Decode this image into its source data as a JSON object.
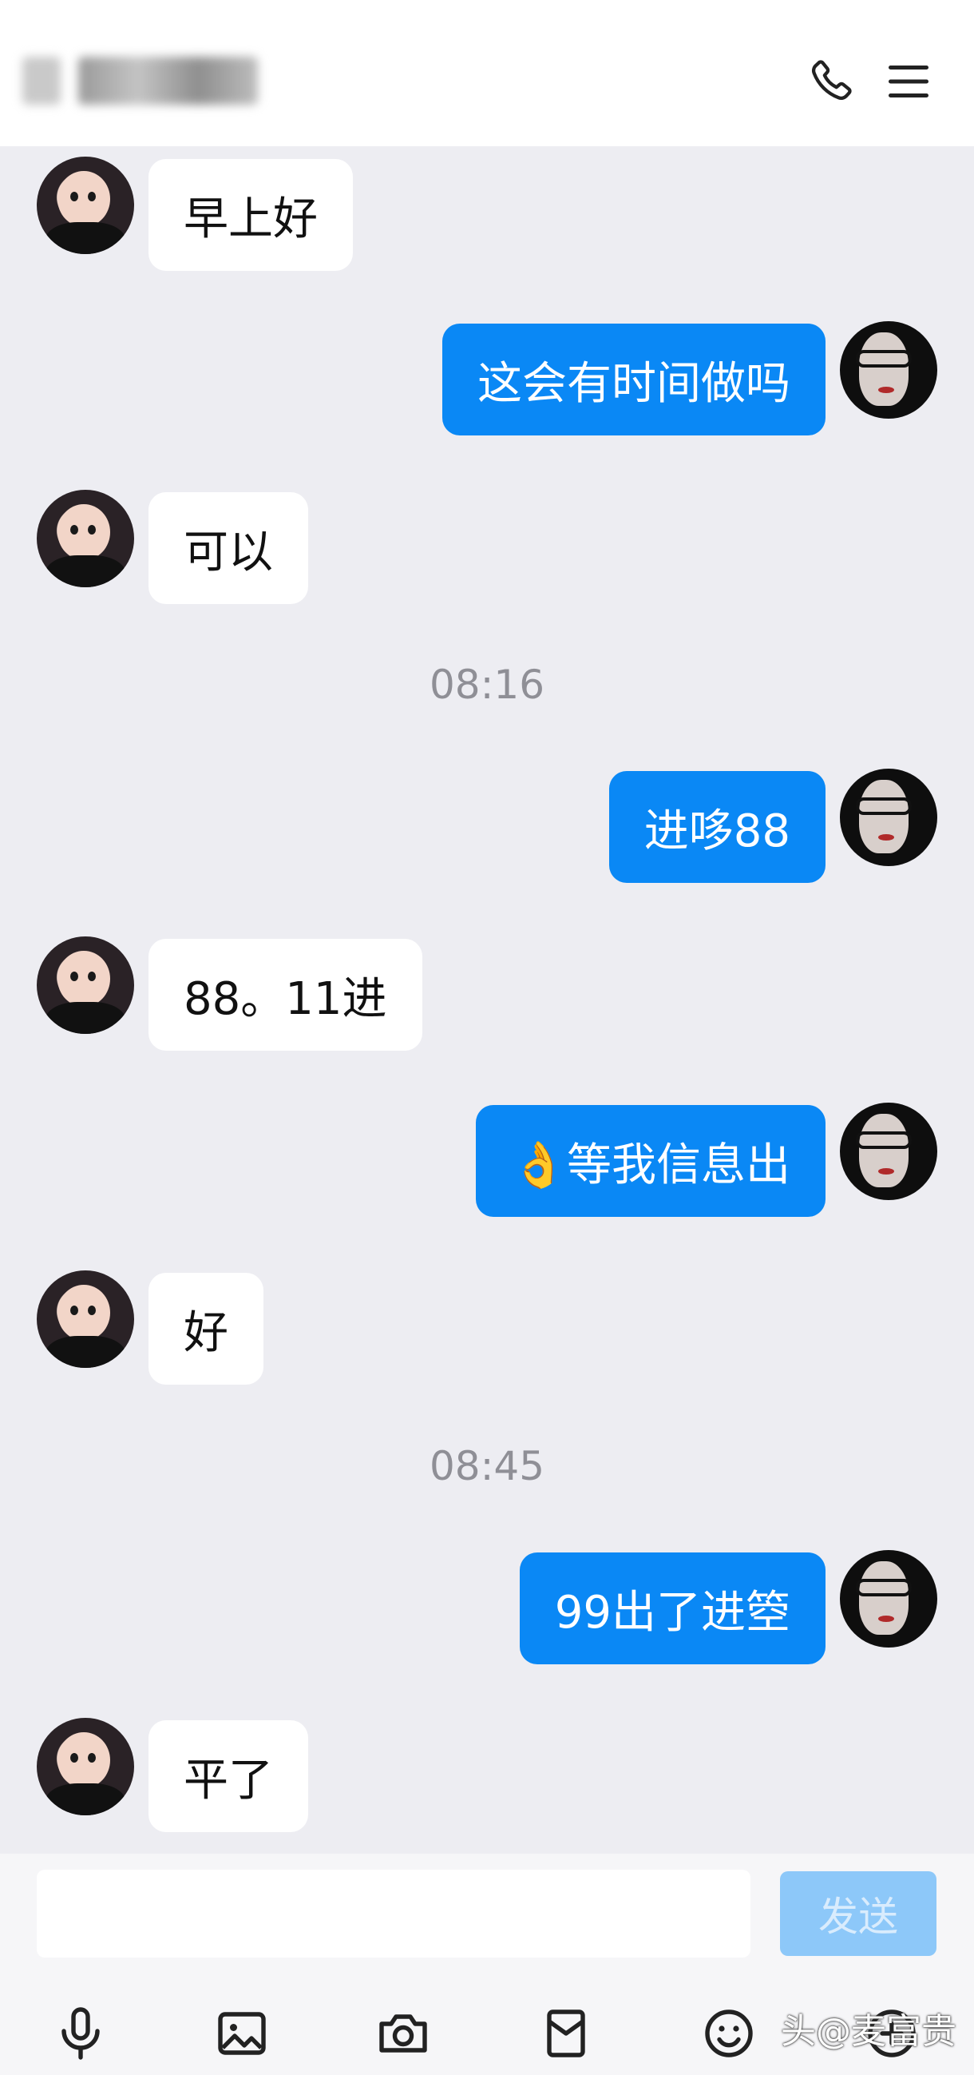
{
  "header": {
    "call_icon": "phone-icon",
    "menu_icon": "hamburger-menu-icon"
  },
  "messages": [
    {
      "side": "in",
      "text": "早上好"
    },
    {
      "side": "out",
      "text": "这会有时间做吗"
    },
    {
      "side": "in",
      "text": "可以"
    },
    {
      "type": "time",
      "text": "08:16"
    },
    {
      "side": "out",
      "text": "进哆88"
    },
    {
      "side": "in",
      "text": "88。11进"
    },
    {
      "side": "out",
      "text": "👌等我信息出"
    },
    {
      "side": "in",
      "text": "好"
    },
    {
      "type": "time",
      "text": "08:45"
    },
    {
      "side": "out",
      "text": "99出了进箜"
    },
    {
      "side": "in",
      "text": "平了"
    }
  ],
  "composer": {
    "input_value": "",
    "send_label": "发送",
    "tools": [
      "microphone-icon",
      "image-icon",
      "camera-icon",
      "red-packet-icon",
      "emoji-icon",
      "more-icon"
    ]
  },
  "watermark": "头@麦富贵",
  "colors": {
    "background": "#ededf2",
    "outgoing_bubble": "#0a88f5",
    "incoming_bubble": "#ffffff",
    "send_button_disabled": "#8dc8f9"
  }
}
